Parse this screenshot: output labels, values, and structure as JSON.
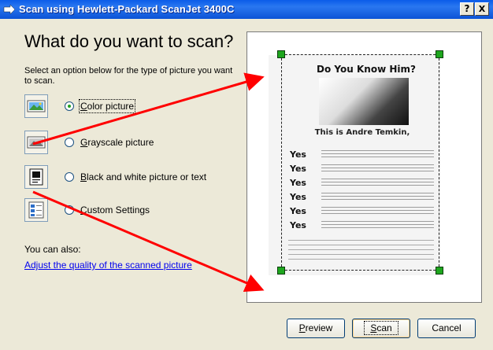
{
  "window": {
    "title": "Scan using Hewlett-Packard ScanJet 3400C",
    "help_label": "?",
    "close_label": "X"
  },
  "dialog": {
    "heading": "What do you want to scan?",
    "instructions": "Select an option below for the type of picture you want to scan.",
    "options": [
      {
        "label": "Color picture",
        "selected": true
      },
      {
        "label": "Grayscale picture",
        "selected": false
      },
      {
        "label": "Black and white picture or text",
        "selected": false
      },
      {
        "label": "Custom Settings",
        "selected": false
      }
    ],
    "also_label": "You can also:",
    "quality_link": "Adjust the quality of the scanned picture"
  },
  "preview_document": {
    "title": "Do You Know Him?",
    "subtitle": "This is Andre Temkin,",
    "bullet_word": "Yes",
    "bullet_count": 7
  },
  "buttons": {
    "preview": "Preview",
    "scan": "Scan",
    "cancel": "Cancel"
  },
  "colors": {
    "titlebar": "#0a5ce9",
    "dialog_bg": "#ece9d8",
    "handle": "#1ea61e",
    "annotation_arrow": "#ff0000"
  }
}
